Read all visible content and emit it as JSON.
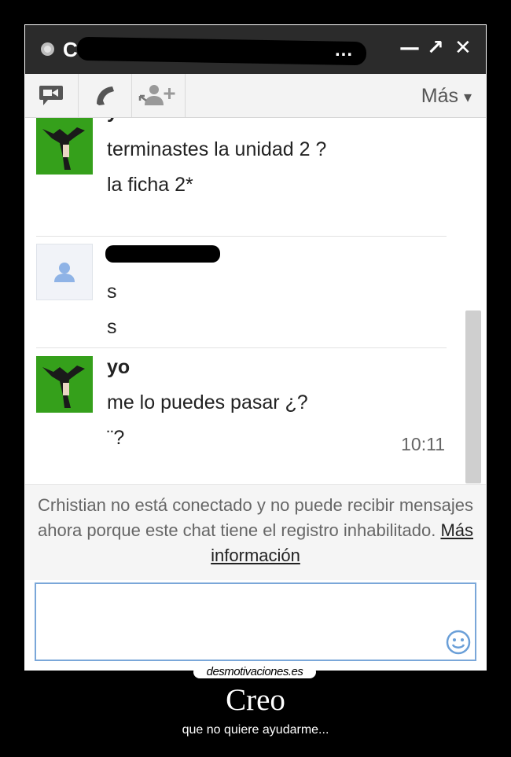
{
  "chat_window": {
    "title_initial": "C",
    "title_ellipsis": "...",
    "window_controls": {
      "minimize": "—",
      "popout": "↗",
      "close": "✕"
    },
    "toolbar": {
      "icons": [
        "video-chat-icon",
        "phone-call-icon",
        "add-person-icon"
      ],
      "more_label": "Más",
      "more_arrow": "▾"
    },
    "messages": [
      {
        "sender": "yo",
        "avatar": "green-photo",
        "lines": [
          "terminastes la unidad 2 ?",
          "la ficha 2*"
        ]
      },
      {
        "sender": "",
        "avatar": "default-person",
        "lines": [
          "s",
          "s"
        ]
      },
      {
        "sender": "yo",
        "avatar": "green-photo",
        "lines": [
          "me lo puedes pasar ¿?",
          "¨?"
        ]
      }
    ],
    "timestamp": "10:11",
    "status": {
      "text": "Crhistian no está conectado y no puede recibir mensajes ahora porque este chat tiene el registro inhabilitado.",
      "link_label": "Más información"
    },
    "compose": {
      "value": "",
      "emoji_icon": "smiley-icon"
    }
  },
  "poster": {
    "watermark": "desmotivaciones.es",
    "title": "Creo",
    "subtitle": "que no quiere ayudarme..."
  },
  "colors": {
    "titlebar": "#2b2b2b",
    "toolbar": "#f3f3f3",
    "compose_border": "#7aa7d9",
    "avatar_green": "#3aa31c",
    "default_avatar_icon": "#8fb3e6"
  }
}
